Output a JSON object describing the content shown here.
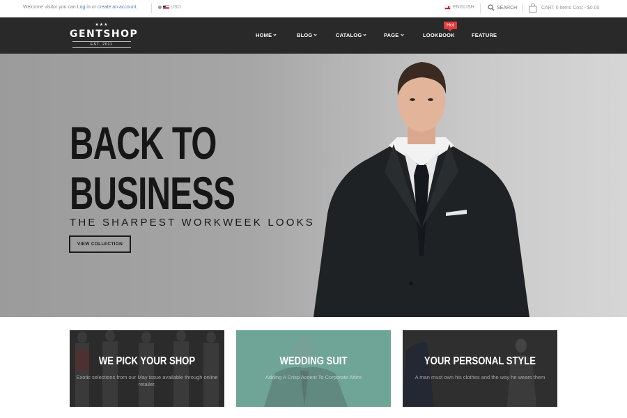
{
  "topbar": {
    "welcome_prefix": "Welcome visitor you can",
    "login_link": "Log in",
    "or_text": "or",
    "create_link": "create an account.",
    "currency": "USD",
    "language": "ENGLISH",
    "search_label": "SEARCH",
    "cart_label": "CART 0 items Cost - $0.00"
  },
  "logo": {
    "stars": "★★★",
    "name": "GENTSHOP",
    "established": "EST. 2011"
  },
  "nav": {
    "items": [
      {
        "label": "HOME",
        "has_dropdown": true
      },
      {
        "label": "BLOG",
        "has_dropdown": true
      },
      {
        "label": "CATALOG",
        "has_dropdown": true
      },
      {
        "label": "PAGE",
        "has_dropdown": true
      },
      {
        "label": "LOOKBOOK",
        "has_dropdown": false
      },
      {
        "label": "FEATURE",
        "has_dropdown": false
      }
    ],
    "hot_badge": "Hot"
  },
  "hero": {
    "line1": "BACK TO",
    "line2": "BUSINESS",
    "subtitle": "THE SHARPEST WORKWEEK LOOKS",
    "button": "VIEW COLLECTION"
  },
  "banners": [
    {
      "title": "WE PICK YOUR SHOP",
      "description": "Exotic selections from our May issue available through online retailer."
    },
    {
      "title": "WEDDING SUIT",
      "description": "Adding A Crisp Accent To Corporate Attire"
    },
    {
      "title": "YOUR PERSONAL STYLE",
      "description": "A man must own his clothes and the way he wears them"
    }
  ],
  "colors": {
    "header_bg": "#292929",
    "hot_badge": "#e13b3b",
    "link": "#5a7fb5",
    "teal_banner": "#6fa597"
  }
}
